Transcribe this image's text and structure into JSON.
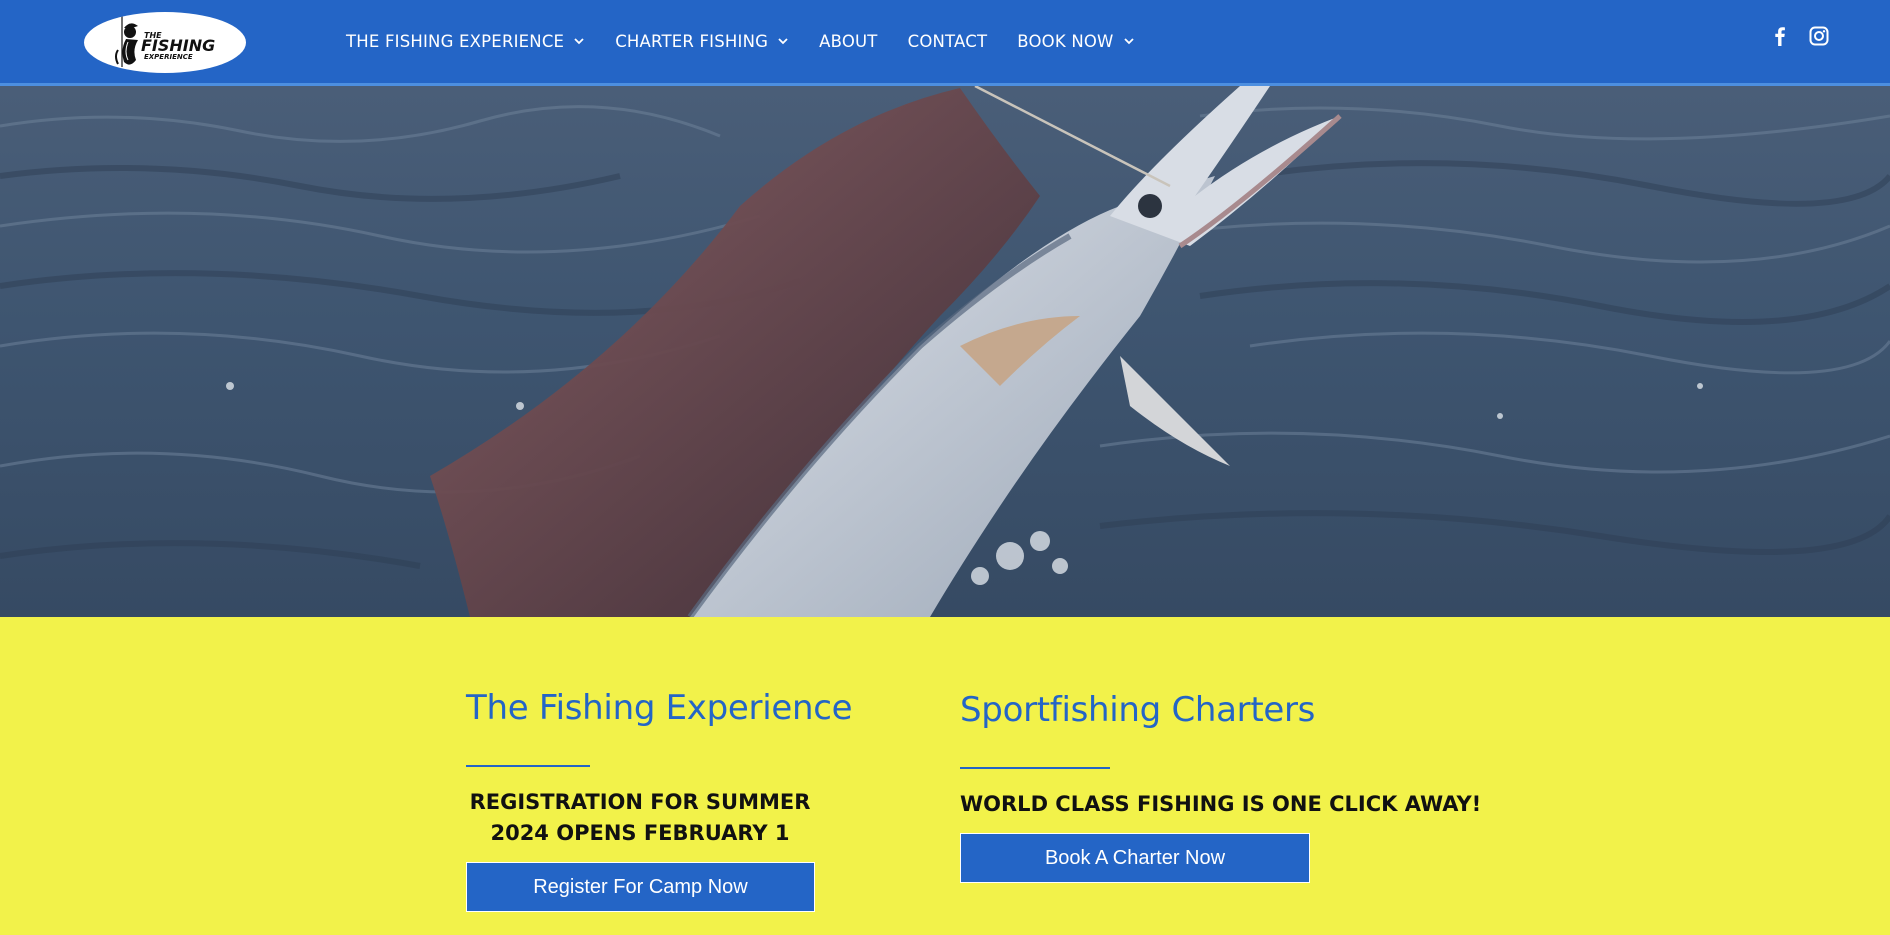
{
  "header": {
    "logo_text_top": "THE",
    "logo_text_main": "FISHING",
    "logo_text_bottom": "EXPERIENCE",
    "nav": [
      {
        "label": "THE FISHING EXPERIENCE",
        "dropdown": true
      },
      {
        "label": "CHARTER FISHING",
        "dropdown": true
      },
      {
        "label": "ABOUT",
        "dropdown": false
      },
      {
        "label": "CONTACT",
        "dropdown": false
      },
      {
        "label": "BOOK NOW",
        "dropdown": true
      }
    ],
    "social": [
      {
        "icon": "facebook-icon"
      },
      {
        "icon": "instagram-icon"
      }
    ]
  },
  "hero": {
    "image": "sailfish-jumping-from-ocean"
  },
  "sections": {
    "left": {
      "title": "The Fishing Experience",
      "subtitle_line1": "REGISTRATION FOR SUMMER",
      "subtitle_line2": "2024 OPENS FEBRUARY 1",
      "button": "Register For Camp Now"
    },
    "right": {
      "title": "Sportfishing Charters",
      "subtitle": "WORLD CLASS FISHING IS ONE CLICK AWAY!",
      "button": "Book A Charter Now"
    }
  },
  "colors": {
    "brand_blue": "#2465c6",
    "accent_yellow": "#f2f24a"
  }
}
